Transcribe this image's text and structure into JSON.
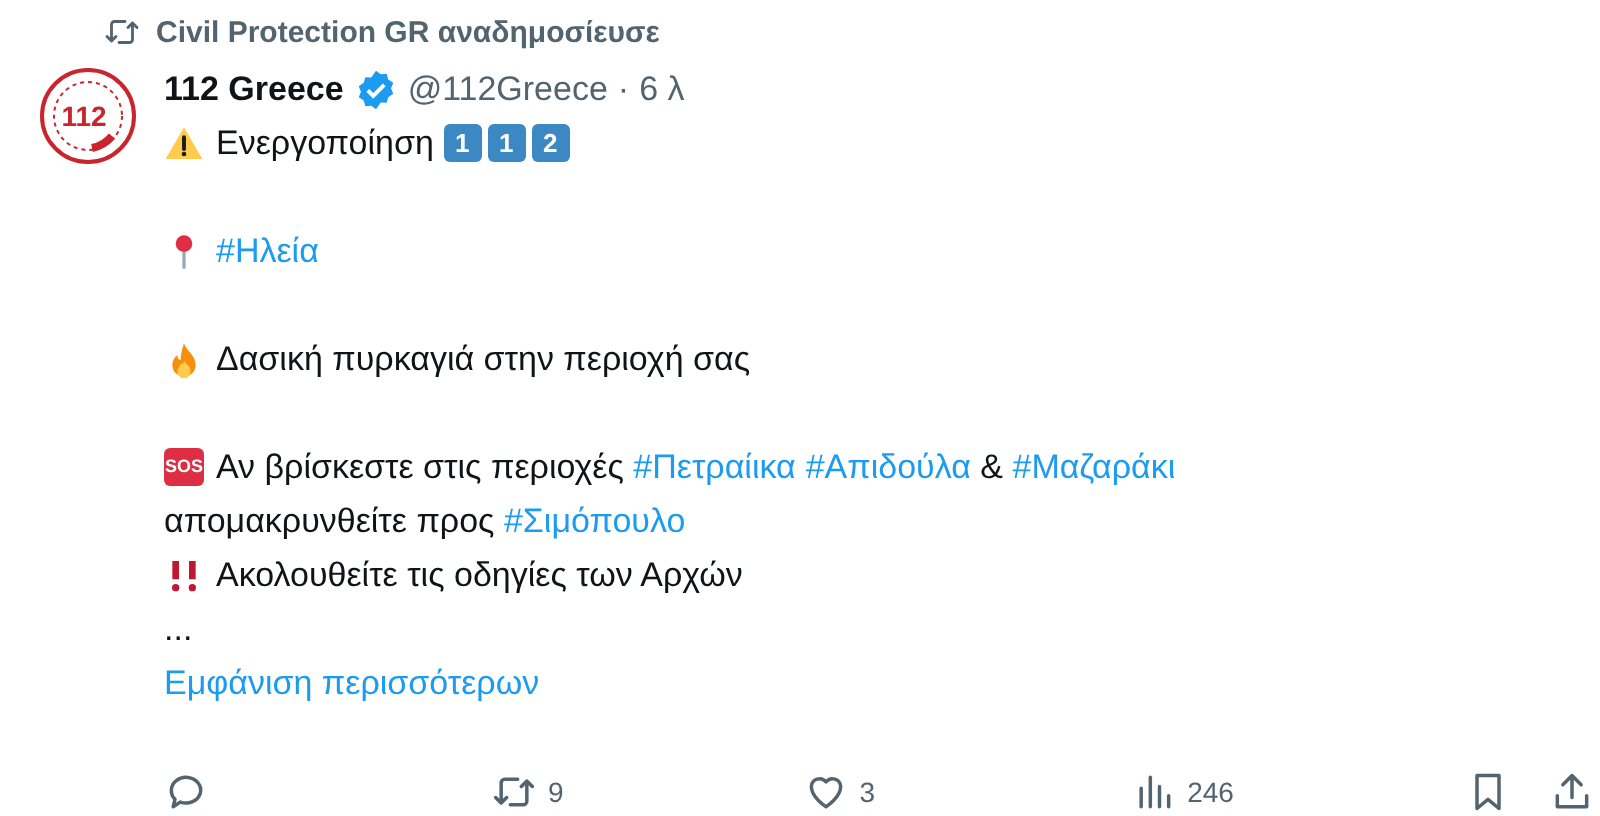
{
  "repost_header": {
    "text": "Civil Protection GR αναδημοσίευσε"
  },
  "author": {
    "name": "112 Greece",
    "verified": true,
    "handle": "@112Greece",
    "separator": "·",
    "time": "6 λ",
    "avatar_text": "112"
  },
  "paragraphs": [
    {
      "lines": [
        [
          {
            "kind": "warning"
          },
          {
            "kind": "text",
            "text": "Ενεργοποίηση "
          },
          {
            "kind": "keycap",
            "text": "1"
          },
          {
            "kind": "keycap",
            "text": "1"
          },
          {
            "kind": "keycap",
            "text": "2"
          }
        ]
      ]
    },
    {
      "lines": [
        [
          {
            "kind": "pin"
          },
          {
            "kind": "hashtag",
            "text": "#Ηλεία"
          }
        ]
      ]
    },
    {
      "lines": [
        [
          {
            "kind": "fire"
          },
          {
            "kind": "text",
            "text": "Δασική πυρκαγιά στην περιοχή σας"
          }
        ]
      ]
    },
    {
      "lines": [
        [
          {
            "kind": "sos",
            "text": "SOS"
          },
          {
            "kind": "text",
            "text": "Αν βρίσκεστε στις περιοχές "
          },
          {
            "kind": "hashtag",
            "text": "#Πετραίικα"
          },
          {
            "kind": "space"
          },
          {
            "kind": "hashtag",
            "text": "#Απιδούλα"
          },
          {
            "kind": "text",
            "text": " & "
          },
          {
            "kind": "hashtag",
            "text": "#Μαζαράκι"
          }
        ],
        [
          {
            "kind": "text",
            "text": "απομακρυνθείτε προς "
          },
          {
            "kind": "hashtag",
            "text": "#Σιμόπουλο"
          }
        ],
        [
          {
            "kind": "bangbang"
          },
          {
            "kind": "text",
            "text": "Ακολουθείτε τις οδηγίες των Αρχών"
          }
        ],
        [
          {
            "kind": "text",
            "text": "..."
          }
        ]
      ]
    }
  ],
  "show_more": "Εμφάνιση περισσότερων",
  "actions": [
    {
      "kind": "reply"
    },
    {
      "kind": "repost",
      "count": "9"
    },
    {
      "kind": "like",
      "count": "3"
    },
    {
      "kind": "views",
      "count": "246"
    },
    {
      "kind": "bookmark"
    },
    {
      "kind": "share"
    }
  ]
}
